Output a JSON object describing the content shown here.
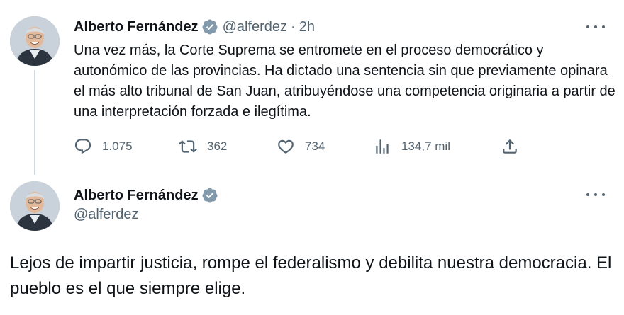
{
  "tweets": [
    {
      "author_name": "Alberto Fernández",
      "handle": "@alferdez",
      "separator": "·",
      "time": "2h",
      "text": "Una vez más, la Corte Suprema se entromete en el proceso democrático y autonómico de las provincias. Ha dictado una sentencia sin que previamente opinara el más alto tribunal de San Juan, atribuyéndose una competencia originaria a partir de una interpretación forzada e ilegítima.",
      "actions": {
        "replies": "1.075",
        "retweets": "362",
        "likes": "734",
        "views": "134,7 mil"
      }
    },
    {
      "author_name": "Alberto Fernández",
      "handle": "@alferdez",
      "text": "Lejos de impartir justicia, rompe el federalismo y debilita nuestra democracia. El pueblo es el que siempre elige."
    }
  ],
  "icons": {
    "verified": "verified-badge-icon",
    "more": "more-options-icon",
    "reply": "reply-icon",
    "retweet": "retweet-icon",
    "like": "heart-icon",
    "views": "views-chart-icon",
    "share": "share-icon"
  },
  "colors": {
    "text_primary": "#0f1419",
    "text_secondary": "#536471",
    "thread_line": "#cfd9de",
    "verified_badge": "#829aab",
    "background": "#ffffff"
  }
}
